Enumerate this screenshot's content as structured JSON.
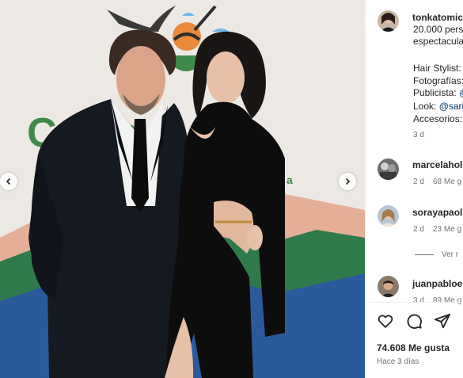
{
  "post": {
    "author": "tonkatomic",
    "caption_lines": [
      "20.000 pers",
      "espectacula",
      "",
      "Hair Stylist:",
      "Fotografías:",
      "Publicista: @",
      "Look: @sari",
      "Accesorios:"
    ],
    "caption_age": "3 d",
    "likes": "74.608 Me gusta",
    "posted": "Hace 3 días",
    "banner_text": "Ca    ue",
    "banner_small": "a"
  },
  "comments": [
    {
      "user": "marcelahols",
      "age": "2 d",
      "likes": "68 Me g"
    },
    {
      "user": "sorayapaola",
      "age": "2 d",
      "likes": "23 Me g"
    },
    {
      "user": "juanpabloe",
      "age": "3 d",
      "likes": "89 Me g"
    }
  ],
  "view_replies": "Ver r",
  "icons": {
    "like": "heart-icon",
    "comment": "comment-icon",
    "share": "send-icon",
    "prev": "chevron-left-icon",
    "next": "chevron-right-icon"
  },
  "colors": {
    "banner_green": "#3f8a4a",
    "mention": "#00376b",
    "muted": "#737373"
  }
}
